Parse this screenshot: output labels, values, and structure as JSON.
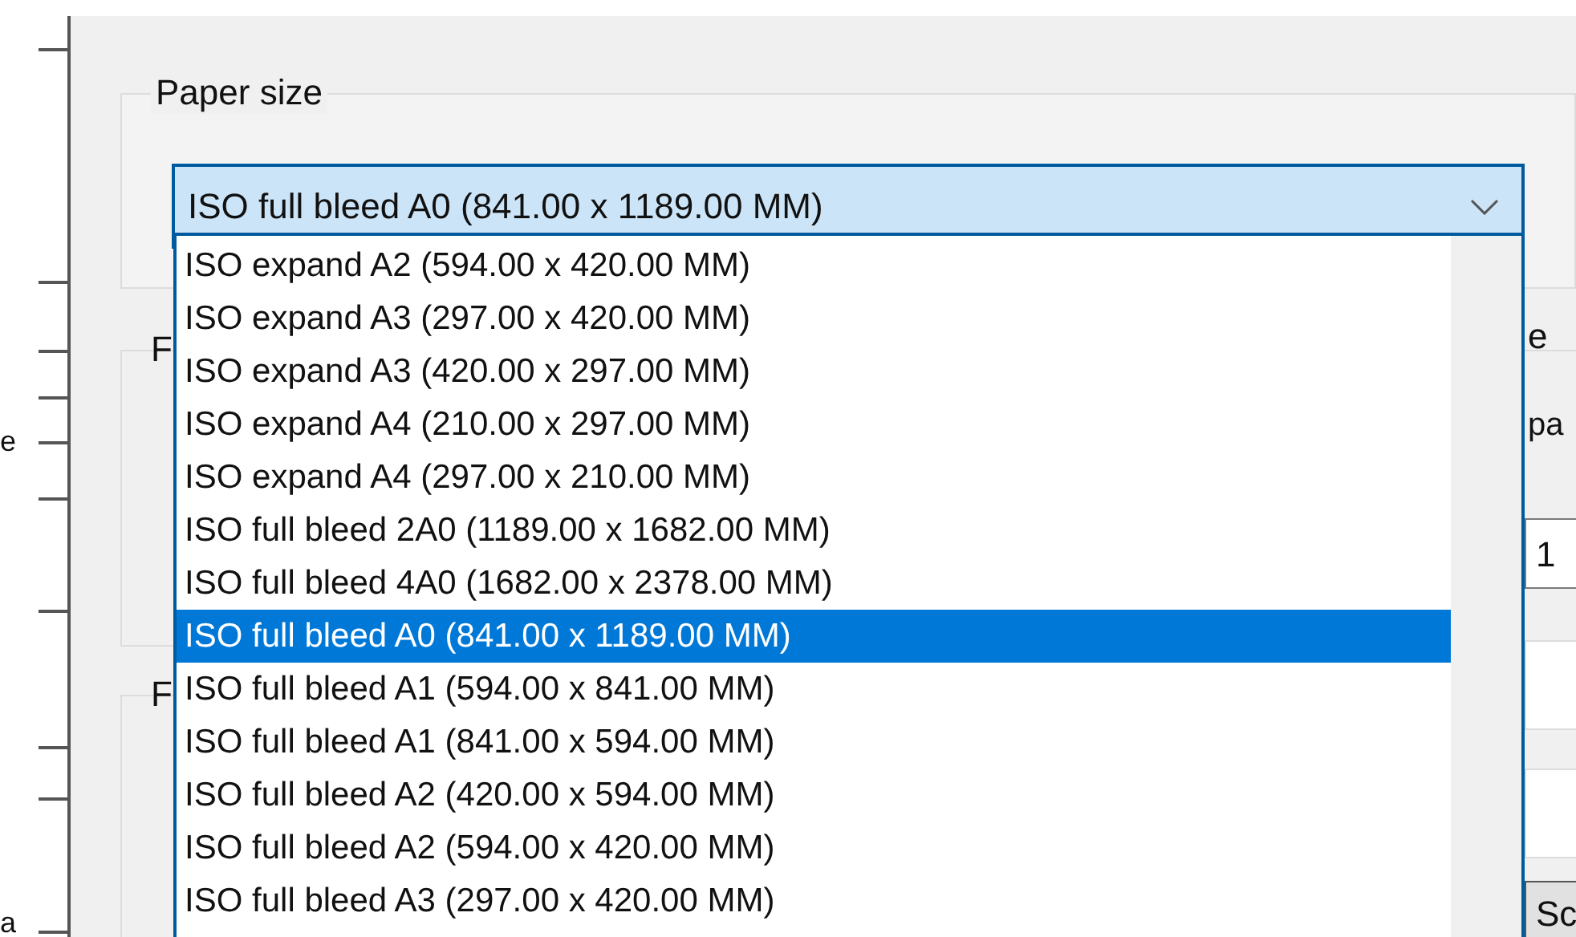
{
  "paper_size_group": {
    "label": "Paper size"
  },
  "combo": {
    "value": "ISO full bleed A0 (841.00 x 1189.00 MM)",
    "expanded": true
  },
  "options": [
    {
      "label": "ISO expand A2 (594.00 x 420.00 MM)",
      "selected": false
    },
    {
      "label": "ISO expand A3 (297.00 x 420.00 MM)",
      "selected": false
    },
    {
      "label": "ISO expand A3 (420.00 x 297.00 MM)",
      "selected": false
    },
    {
      "label": "ISO expand A4 (210.00 x 297.00 MM)",
      "selected": false
    },
    {
      "label": "ISO expand A4 (297.00 x 210.00 MM)",
      "selected": false
    },
    {
      "label": "ISO full bleed 2A0 (1189.00 x 1682.00 MM)",
      "selected": false
    },
    {
      "label": "ISO full bleed 4A0 (1682.00 x 2378.00 MM)",
      "selected": false
    },
    {
      "label": "ISO full bleed A0 (841.00 x 1189.00 MM)",
      "selected": true
    },
    {
      "label": "ISO full bleed A1 (594.00 x 841.00 MM)",
      "selected": false
    },
    {
      "label": "ISO full bleed A1 (841.00 x 594.00 MM)",
      "selected": false
    },
    {
      "label": "ISO full bleed A2 (420.00 x 594.00 MM)",
      "selected": false
    },
    {
      "label": "ISO full bleed A2 (594.00 x 420.00 MM)",
      "selected": false
    },
    {
      "label": "ISO full bleed A3 (297.00 x 420.00 MM)",
      "selected": false
    }
  ],
  "hidden_group_labels": [
    "F",
    "F"
  ],
  "right_edge": {
    "group_label": "e",
    "text": "pa",
    "field_value": "1",
    "button_label": "Sc"
  },
  "left_edge": [
    "e",
    "a"
  ]
}
